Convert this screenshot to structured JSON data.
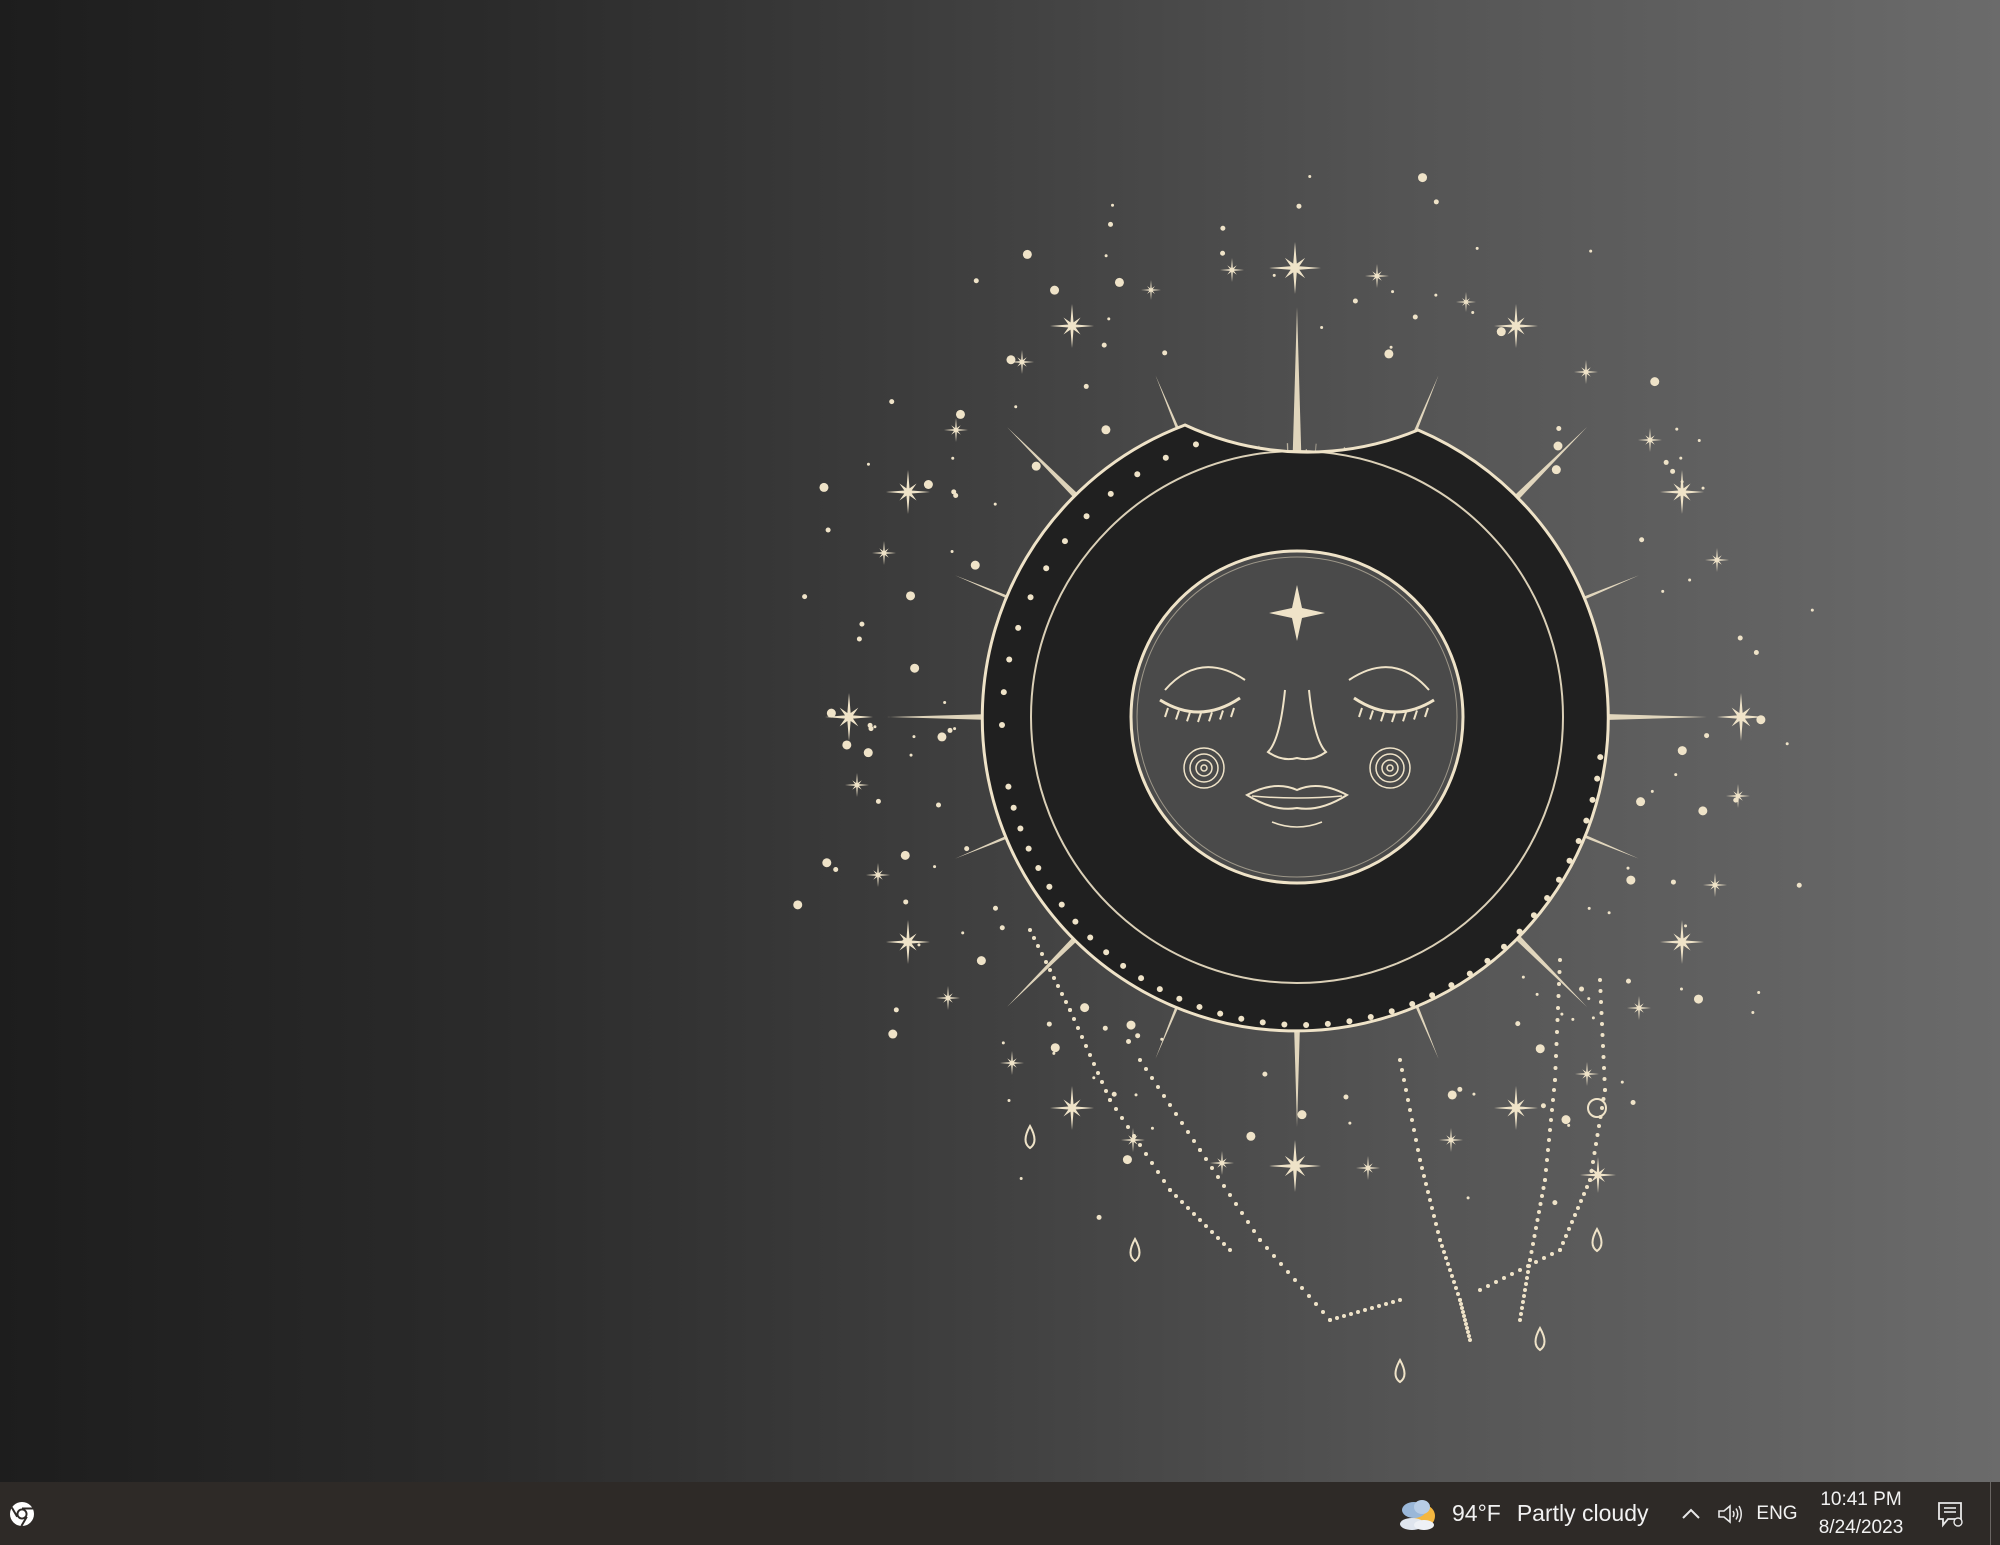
{
  "taskbar": {
    "pinned": [
      {
        "name": "Google Chrome",
        "icon": "chrome-icon"
      }
    ],
    "weather": {
      "temperature": "94°F",
      "condition": "Partly cloudy",
      "icon": "partly-cloudy-sun-icon"
    },
    "tray": {
      "chevron_icon": "chevron-up-icon",
      "volume_icon": "speaker-icon",
      "language": "ENG"
    },
    "clock": {
      "time": "10:41 PM",
      "date": "8/24/2023"
    },
    "notification_icon": "notification-icon"
  },
  "colors": {
    "art": "#efe3c8",
    "crescent": "#202020",
    "taskbar_bg": "#2e2a27"
  }
}
